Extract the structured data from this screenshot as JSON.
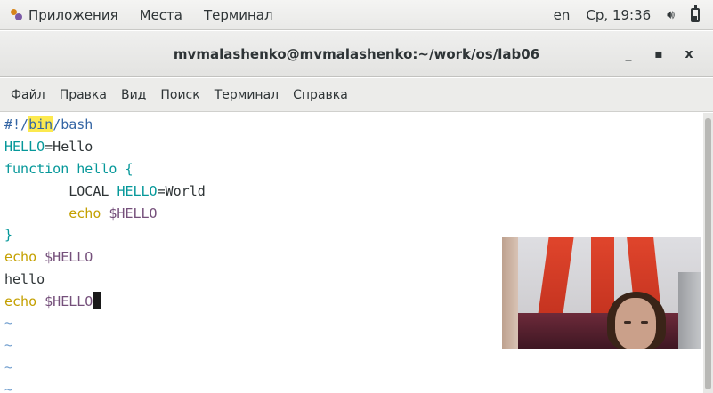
{
  "top_panel": {
    "applications": "Приложения",
    "places": "Места",
    "terminal": "Терминал",
    "keyboard_layout": "en",
    "clock": "Ср, 19:36"
  },
  "window": {
    "title": "mvmalashenko@mvmalashenko:~/work/os/lab06",
    "minimize": "_",
    "maximize": "▪",
    "close": "x"
  },
  "menubar": [
    "Файл",
    "Правка",
    "Вид",
    "Поиск",
    "Терминал",
    "Справка"
  ],
  "editor": {
    "shebang_prefix": "#!/",
    "shebang_highlight": "bin",
    "shebang_suffix": "/bash",
    "line2_var": "HELLO",
    "line2_rest": "=Hello",
    "line3": "function hello {",
    "line4_indent": "        LOCAL ",
    "line4_var": "HELLO",
    "line4_rest": "=World",
    "line5_indent": "        ",
    "line5_echo": "echo",
    "line5_var": " $HELLO",
    "line6": "}",
    "line7_echo": "echo",
    "line7_var": " $HELLO",
    "line8": "hello",
    "line9_echo": "echo",
    "line9_var": " $HELLO",
    "tilde": "~"
  },
  "colors": {
    "keyword": "#06989a",
    "echo": "#c4a000",
    "variable": "#75507b",
    "comment": "#3465a4",
    "highlight": "#fce94f"
  },
  "icons": [
    "applications-icon",
    "volume-icon",
    "battery-icon"
  ]
}
